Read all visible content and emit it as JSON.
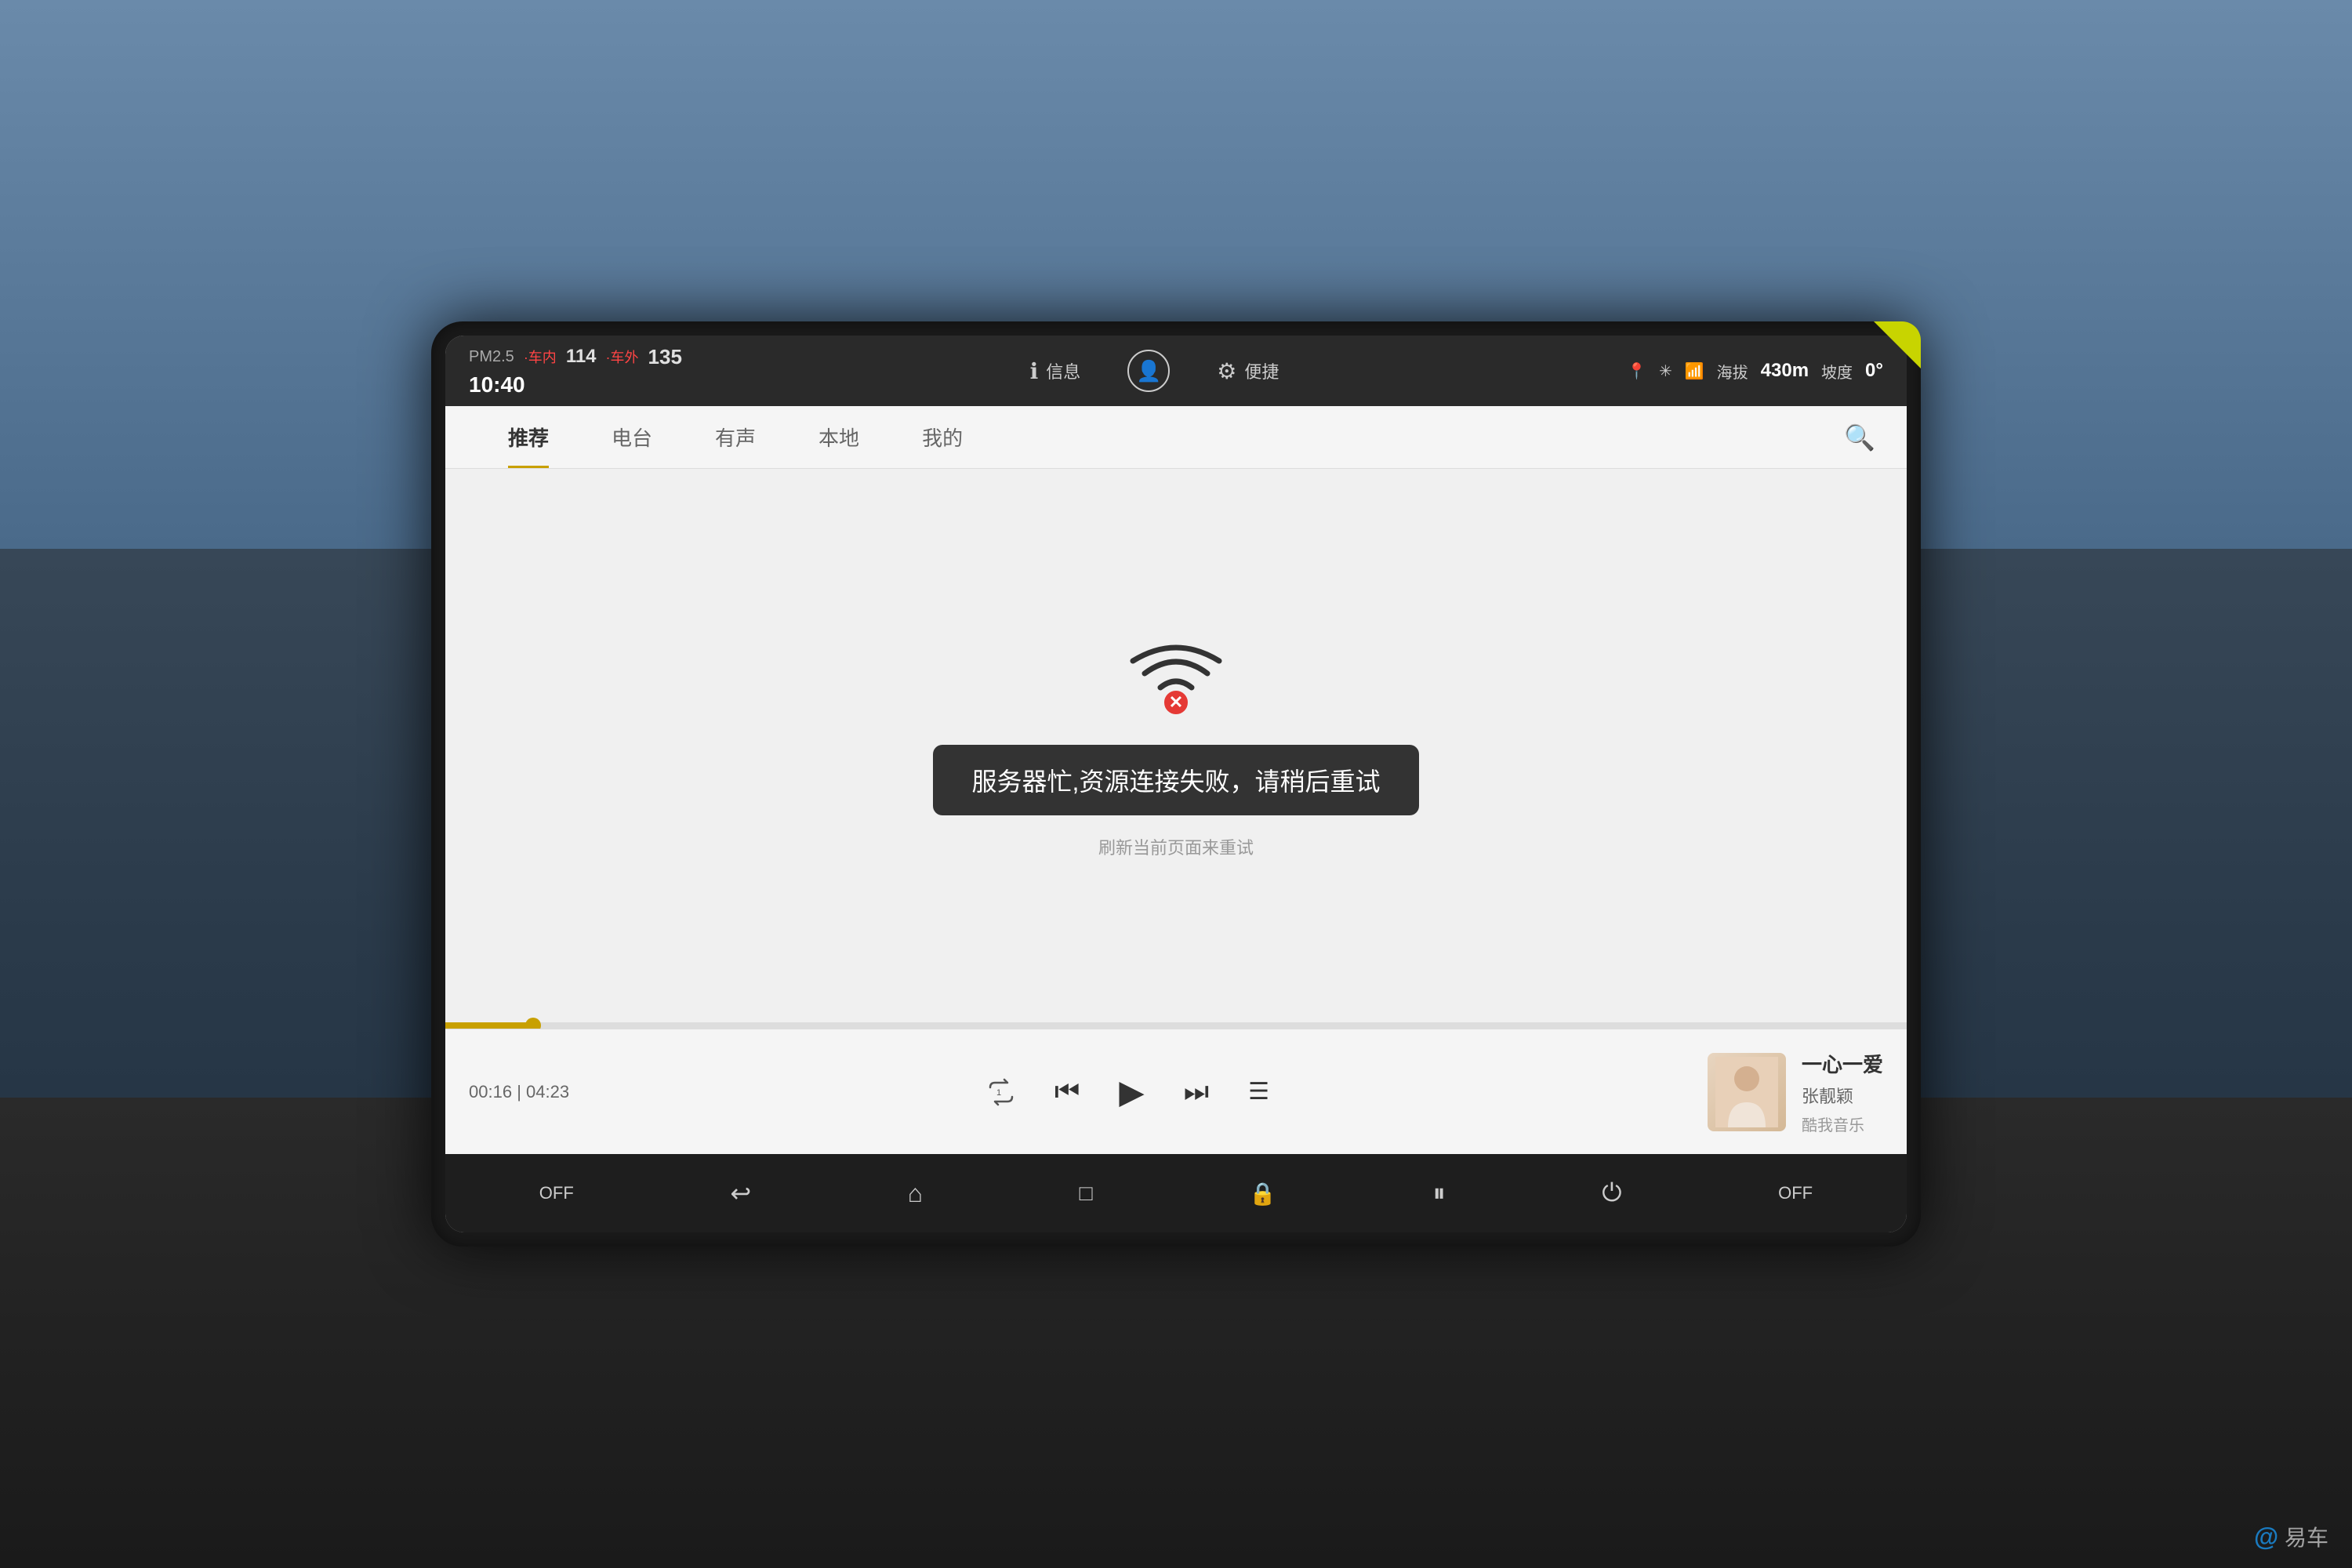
{
  "background": {
    "description": "Car interior with infotainment screen"
  },
  "statusBar": {
    "pm25Label": "PM2.5",
    "interiorLabel": "·车内",
    "interiorValue": "114",
    "exteriorLabel": "·车外",
    "exteriorValue": "135",
    "time": "10:40",
    "infoLabel": "信息",
    "convenienceLabel": "便捷",
    "altitudeLabel": "海拔",
    "altitudeValue": "430m",
    "slopeLabel": "坡度",
    "slopeValue": "0°"
  },
  "navTabs": {
    "items": [
      {
        "label": "推荐",
        "active": true
      },
      {
        "label": "电台",
        "active": false
      },
      {
        "label": "有声",
        "active": false
      },
      {
        "label": "本地",
        "active": false
      },
      {
        "label": "我的",
        "active": false
      }
    ]
  },
  "errorState": {
    "wifiErrorIcon": "wifi-x-icon",
    "errorMessage": "服务器忙,资源连接失败，请稍后重试",
    "retryText": "刷新当前页面来重试"
  },
  "playerBar": {
    "currentTime": "00:16",
    "totalTime": "04:23",
    "trackTitle": "一心一爱",
    "trackArtist": "张靓颖",
    "trackSource": "酷我音乐",
    "progressPercent": 6
  },
  "bottomNav": {
    "items": [
      {
        "label": "OFF",
        "icon": "power-off-left"
      },
      {
        "label": "←",
        "icon": "back-icon"
      },
      {
        "label": "⌂",
        "icon": "home-icon"
      },
      {
        "label": "□",
        "icon": "recents-icon"
      },
      {
        "label": "🔒",
        "icon": "lock-icon"
      },
      {
        "label": "⏸",
        "icon": "pause-icon"
      },
      {
        "label": "⏻",
        "icon": "power-icon"
      },
      {
        "label": "OFF",
        "icon": "power-off-right"
      }
    ]
  },
  "watermark": "易车"
}
